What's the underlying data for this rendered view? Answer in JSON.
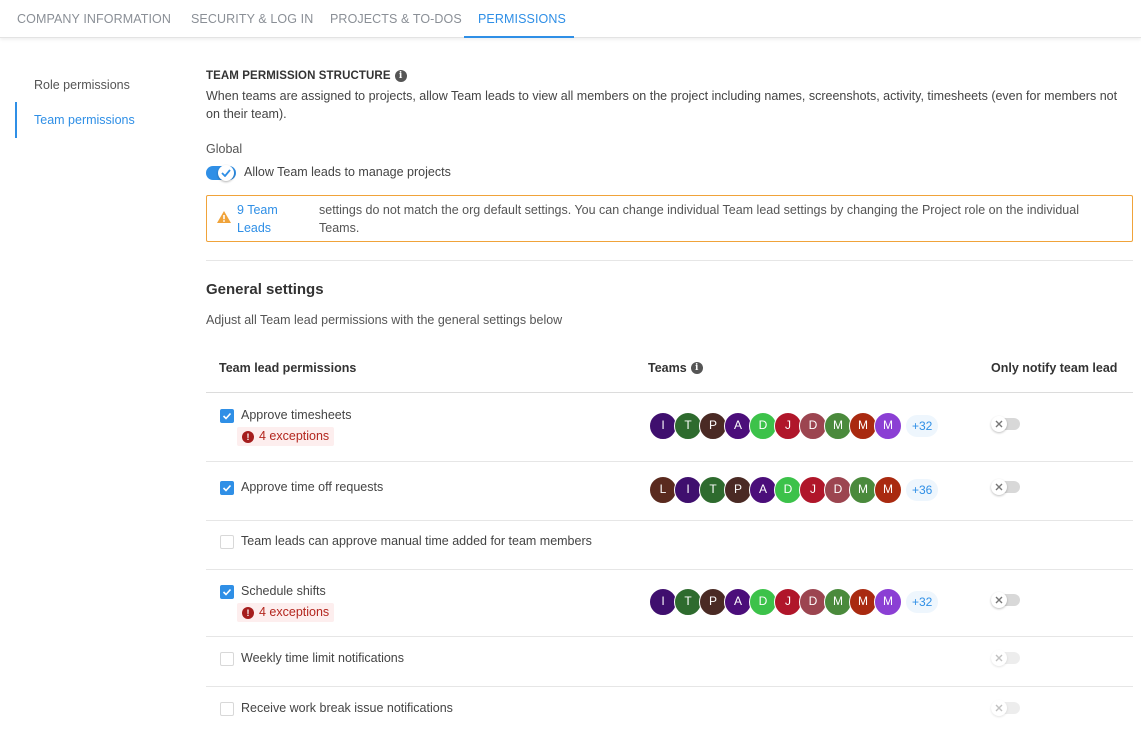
{
  "tabs": [
    {
      "label": "COMPANY INFORMATION"
    },
    {
      "label": "SECURITY & LOG IN"
    },
    {
      "label": "PROJECTS & TO-DOS"
    },
    {
      "label": "PERMISSIONS"
    }
  ],
  "sidenav": {
    "items": [
      {
        "label": "Role permissions"
      },
      {
        "label": "Team permissions"
      }
    ]
  },
  "structure": {
    "title": "TEAM PERMISSION STRUCTURE",
    "description": "When teams are assigned to projects, allow Team leads to view all members on the project including names, screenshots, activity, timesheets (even for members not on their team).",
    "global_label": "Global",
    "toggle_label": "Allow Team leads to manage projects",
    "toggle_on": true
  },
  "warning": {
    "link": "9 Team Leads",
    "text": "settings do not match the org default settings. You can change individual Team lead settings by changing the Project role on the individual Teams."
  },
  "general": {
    "title": "General settings",
    "description": "Adjust all Team lead permissions with the general settings below"
  },
  "table": {
    "headers": {
      "permissions": "Team lead permissions",
      "teams": "Teams",
      "notify": "Only notify team lead"
    },
    "rows": [
      {
        "label": "Approve timesheets",
        "checked": true,
        "exceptions": "4 exceptions",
        "avatars": [
          "I",
          "T",
          "P",
          "A",
          "D",
          "J",
          "D",
          "M",
          "M",
          "M"
        ],
        "avatar_colors": [
          "#3f0f6e",
          "#2e6b2e",
          "#4a2a24",
          "#4b0e7a",
          "#3cc24a",
          "#b0162a",
          "#9c4550",
          "#4a8a3c",
          "#a92a10",
          "#8b3fd4"
        ],
        "more": "+32",
        "toggle": "off"
      },
      {
        "label": "Approve time off requests",
        "checked": true,
        "exceptions": "",
        "avatars": [
          "L",
          "I",
          "T",
          "P",
          "A",
          "D",
          "J",
          "D",
          "M",
          "M"
        ],
        "avatar_colors": [
          "#5a2a1e",
          "#3f0f6e",
          "#2e6b2e",
          "#4a2a24",
          "#4b0e7a",
          "#3cc24a",
          "#b0162a",
          "#9c4550",
          "#4a8a3c",
          "#a92a10"
        ],
        "more": "+36",
        "toggle": "off"
      },
      {
        "label": "Team leads can approve manual time added for team members",
        "checked": false,
        "exceptions": "",
        "avatars": [],
        "avatar_colors": [],
        "more": "",
        "toggle": "none"
      },
      {
        "label": "Schedule shifts",
        "checked": true,
        "exceptions": "4 exceptions",
        "avatars": [
          "I",
          "T",
          "P",
          "A",
          "D",
          "J",
          "D",
          "M",
          "M",
          "M"
        ],
        "avatar_colors": [
          "#3f0f6e",
          "#2e6b2e",
          "#4a2a24",
          "#4b0e7a",
          "#3cc24a",
          "#b0162a",
          "#9c4550",
          "#4a8a3c",
          "#a92a10",
          "#8b3fd4"
        ],
        "more": "+32",
        "toggle": "off"
      },
      {
        "label": "Weekly time limit notifications",
        "checked": false,
        "exceptions": "",
        "avatars": [],
        "avatar_colors": [],
        "more": "",
        "toggle": "disabled"
      },
      {
        "label": "Receive work break issue notifications",
        "checked": false,
        "exceptions": "",
        "avatars": [],
        "avatar_colors": [],
        "more": "",
        "toggle": "disabled"
      }
    ]
  },
  "colors": {
    "accent": "#2f8fe6",
    "warning_border": "#f0a33a",
    "exception_text": "#b3261e"
  }
}
